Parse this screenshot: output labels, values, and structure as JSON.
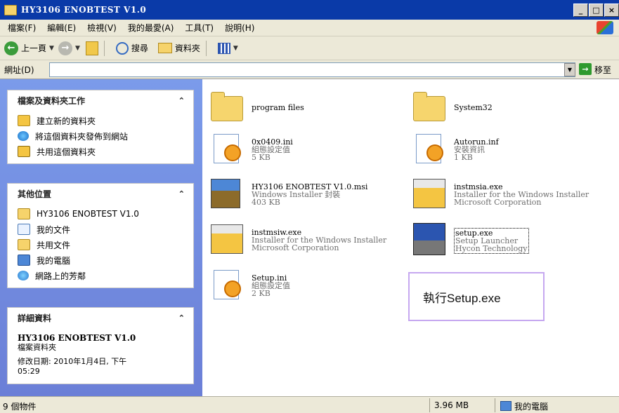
{
  "window": {
    "title": "HY3106 ENOBTEST V1.0",
    "controls": [
      "_",
      "□",
      "×"
    ]
  },
  "menubar": {
    "items": [
      "檔案(F)",
      "編輯(E)",
      "檢視(V)",
      "我的最愛(A)",
      "工具(T)",
      "說明(H)"
    ]
  },
  "toolbar": {
    "back_label": "上一頁",
    "search_label": "搜尋",
    "folders_label": "資料夾"
  },
  "address": {
    "label": "網址(D)",
    "value": "",
    "go_label": "移至"
  },
  "tasks_panel": {
    "title": "檔案及資料夾工作",
    "items": [
      "建立新的資料夾",
      "將這個資料夾發佈到網站",
      "共用這個資料夾"
    ]
  },
  "places_panel": {
    "title": "其他位置",
    "items": [
      "HY3106 ENOBTEST V1.0",
      "我的文件",
      "共用文件",
      "我的電腦",
      "網路上的芳鄰"
    ]
  },
  "details_panel": {
    "title": "詳細資料",
    "name": "HY3106 ENOBTEST V1.0",
    "type": "檔案資料夾",
    "modified": "修改日期: 2010年1月4日, 下午",
    "modified_time": "05:29"
  },
  "files": [
    {
      "name": "program files",
      "line2": "",
      "line3": ""
    },
    {
      "name": "System32",
      "line2": "",
      "line3": ""
    },
    {
      "name": "0x0409.ini",
      "line2": "組態設定值",
      "line3": "5 KB"
    },
    {
      "name": "Autorun.inf",
      "line2": "安裝資訊",
      "line3": "1 KB"
    },
    {
      "name": "HY3106 ENOBTEST V1.0.msi",
      "line2": "Windows Installer 封裝",
      "line3": "403 KB"
    },
    {
      "name": "instmsia.exe",
      "line2": "Installer for the Windows Installer",
      "line3": "Microsoft Corporation"
    },
    {
      "name": "instmsiw.exe",
      "line2": "Installer for the Windows Installer",
      "line3": "Microsoft Corporation"
    },
    {
      "name": "setup.exe",
      "line2": "Setup Launcher",
      "line3": "Hycon Technology"
    },
    {
      "name": "Setup.ini",
      "line2": "組態設定值",
      "line3": "2 KB"
    }
  ],
  "callout": {
    "text": "執行Setup.exe"
  },
  "statusbar": {
    "count": "9 個物件",
    "size": "3.96 MB",
    "location": "我的電腦"
  }
}
